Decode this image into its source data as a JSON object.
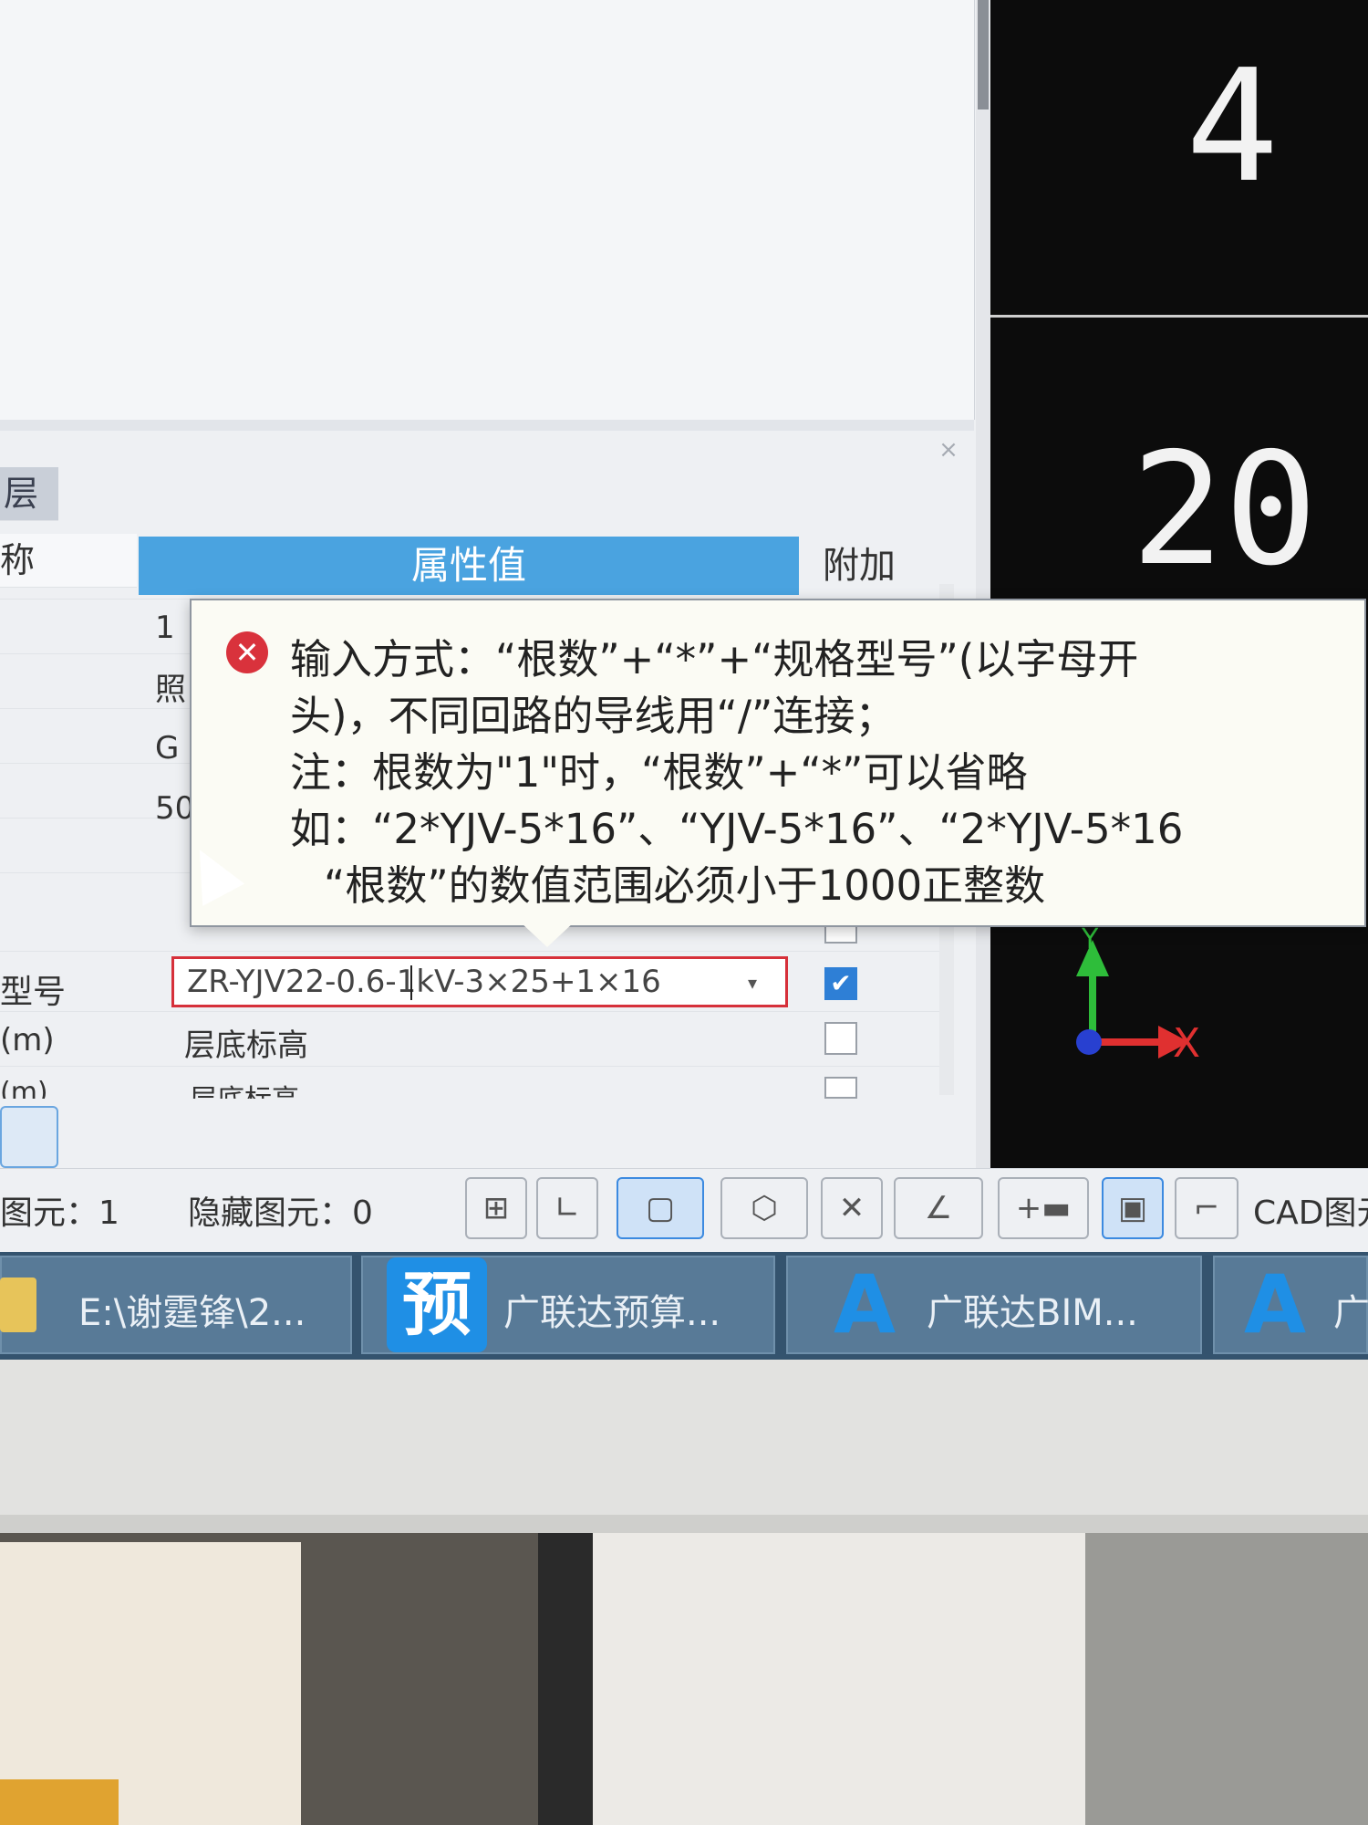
{
  "cad_labels": {
    "top_number": "4",
    "middle_number": "20",
    "axis_y": "Y",
    "axis_x": "X"
  },
  "panel": {
    "close_glyph": "×",
    "layer_label": "层",
    "name_label": "称",
    "header_value": "属性值",
    "header_attach": "附加"
  },
  "rows": {
    "r1": "1",
    "r2": "照",
    "r3": "G",
    "r4": "50",
    "spec_label": "型号",
    "spec_value": "ZR-YJV22-0.6-1kV-3×25+1×16",
    "spec_dropdown": "▾",
    "spec_checked": "✔",
    "floor_label": "(m)",
    "floor_value": "层底标高",
    "floor_label2": "(m)",
    "floor_value2": "层底标高"
  },
  "tooltip": {
    "icon": "✕",
    "line1": "输入方式：“根数”+“*”+“规格型号”(以字母开",
    "line2": "头)，不同回路的导线用“/”连接；",
    "line3": "注：根数为\"1\"时，“根数”+“*”可以省略",
    "line4": "如：“2*YJV-5*16”、“YJV-5*16”、“2*YJV-5*16",
    "line5": "“根数”的数值范围必须小于1000正整数"
  },
  "status": {
    "elements": "图元：1",
    "hidden": "隐藏图元：0",
    "cad": "CAD图元"
  },
  "tools": [
    "⊞",
    "∟",
    "▢",
    "⬡",
    "✕",
    "∠",
    "+▬",
    "▣",
    "⌐"
  ],
  "taskbar": {
    "item1": "E:\\谢霆锋\\2...",
    "item2_icon": "预",
    "item2": "广联达预算...",
    "item3_icon": "A",
    "item3": "广联达BIM...",
    "item4_icon": "A",
    "item4": "广"
  }
}
